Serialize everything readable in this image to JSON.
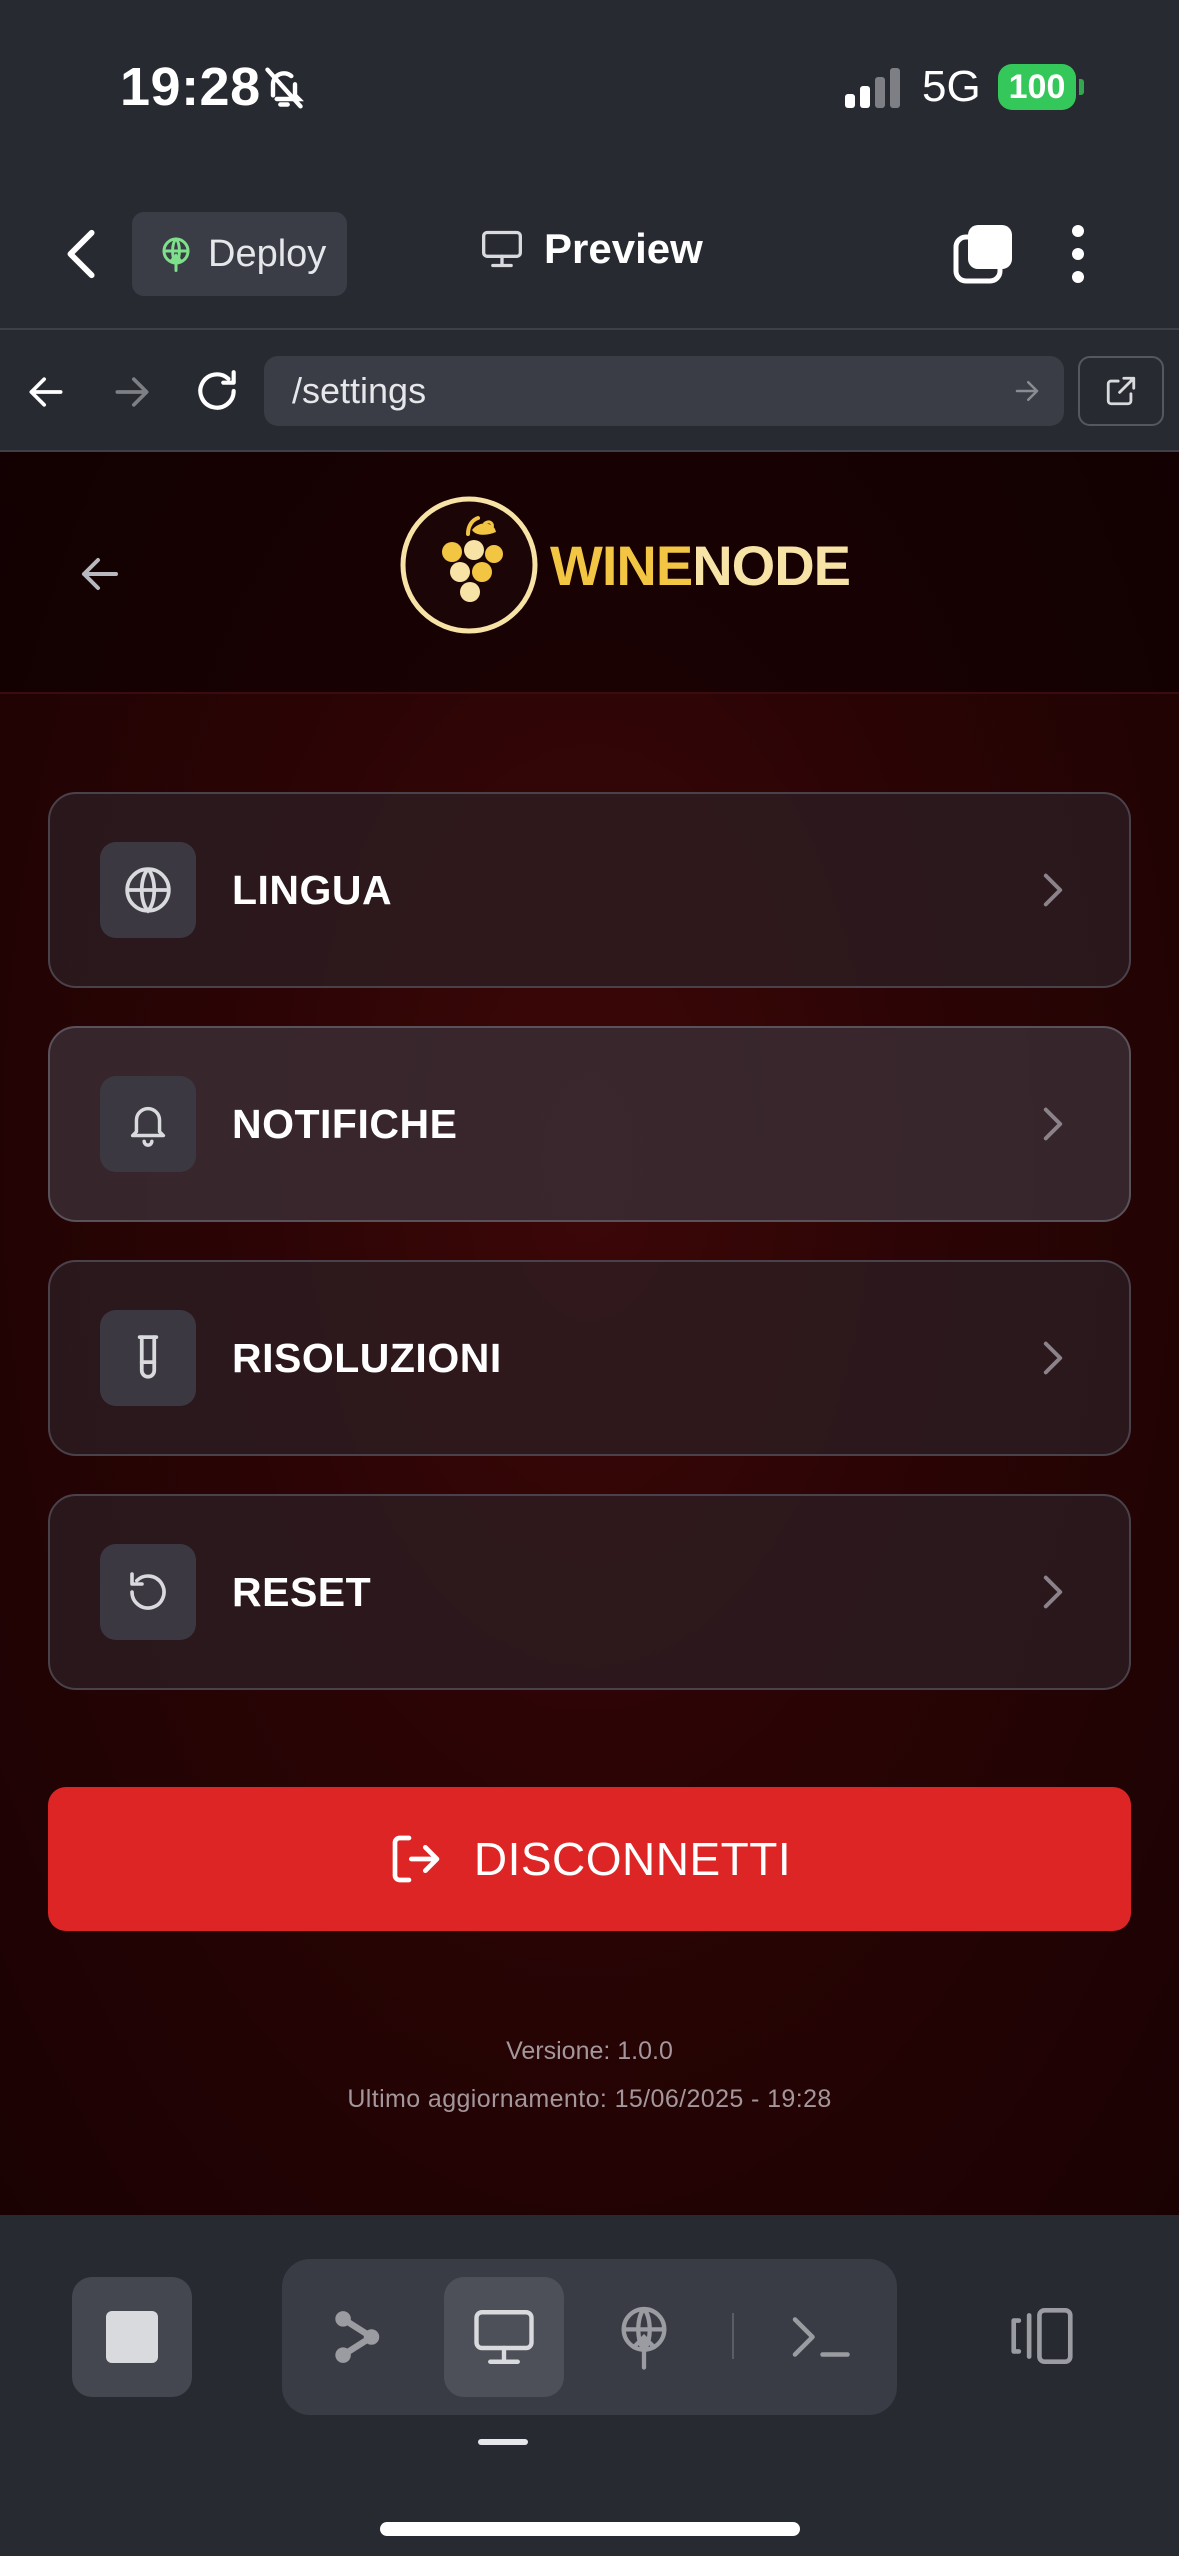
{
  "status_bar": {
    "time": "19:28",
    "network": "5G",
    "battery": "100"
  },
  "app_bar": {
    "deploy_label": "Deploy",
    "preview_label": "Preview"
  },
  "url_bar": {
    "url": "/settings"
  },
  "site": {
    "logo": {
      "part1": "WINE",
      "part2": "NODE"
    },
    "menu": [
      {
        "label": "LINGUA",
        "icon": "globe-icon"
      },
      {
        "label": "NOTIFICHE",
        "icon": "bell-icon"
      },
      {
        "label": "RISOLUZIONI",
        "icon": "test-tube-icon"
      },
      {
        "label": "RESET",
        "icon": "reset-icon"
      }
    ],
    "logout_label": "DISCONNETTI",
    "version": "Versione: 1.0.0",
    "last_update": "Ultimo aggiornamento: 15/06/2025 - 19:28"
  },
  "colors": {
    "accent_red": "#dd2526",
    "logo_gold": "#f2c543",
    "battery_green": "#34c759"
  }
}
